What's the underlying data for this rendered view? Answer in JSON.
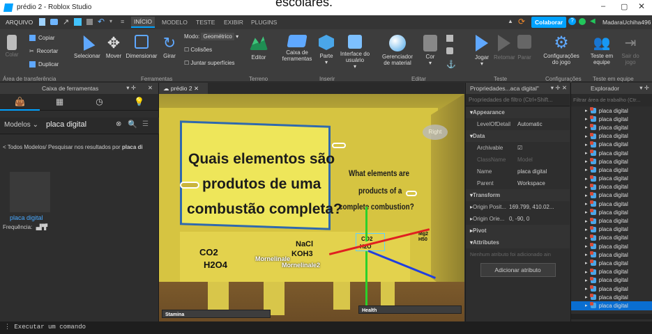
{
  "window": {
    "title": "prédio 2 - Roblox Studio",
    "partial_caption": "escolares."
  },
  "menu": {
    "arquivo": "ARQUIVO",
    "inicio": "INÍCIO",
    "modelo": "MODELO",
    "teste": "TESTE",
    "exibir": "EXIBIR",
    "plugins": "PLUGINS",
    "colaborar": "Colaborar",
    "user": "MadaraUchiha496"
  },
  "ribbon": {
    "clipboard": {
      "colar": "Colar",
      "copiar": "Copiar",
      "recortar": "Recortar",
      "duplicar": "Duplicar",
      "group": "Área de transferência"
    },
    "tools": {
      "selecionar": "Selecionar",
      "mover": "Mover",
      "dimensionar": "Dimensionar",
      "girar": "Girar",
      "modo_label": "Modo:",
      "modo_value": "Geométrico",
      "colisoes": "Colisões",
      "juntar": "Juntar superfícies",
      "group": "Ferramentas"
    },
    "terrain": {
      "editor": "Editor",
      "group": "Terreno"
    },
    "insert": {
      "caixa": "Caixa de ferramentas",
      "parte": "Parte",
      "interface": "Interface do usuário",
      "group": "Inserir"
    },
    "edit": {
      "gerenciador": "Gerenciador de material",
      "cor": "Cor",
      "group": "Editar"
    },
    "test": {
      "jogar": "Jogar",
      "retomar": "Retomar",
      "parar": "Parar",
      "group": "Teste"
    },
    "settings": {
      "config": "Configurações do jogo",
      "group": "Configurações"
    },
    "team": {
      "teste_equipe": "Teste em equipe",
      "sair": "Sair do jogo",
      "group": "Teste em equipe"
    }
  },
  "toolbox": {
    "title": "Caixa de ferramentas",
    "category": "Modelos",
    "search_value": "placa digital",
    "breadcrumb_prefix": "< Todos Modelos/ Pesquisar nos resultados por ",
    "breadcrumb_query": "placa di",
    "result_name": "placa digital",
    "frequency_label": "Frequência:"
  },
  "viewport": {
    "tab": "prédio 2",
    "board_pt_line1": "Quais elementos são",
    "board_pt_line2": "produtos de uma",
    "board_pt_line3": "combustão completa?",
    "board_en_line1": "What elements are",
    "board_en_line2": "products of a",
    "board_en_line3": "complete combustion?",
    "co2": "CO2",
    "h2o4": "H2O4",
    "nacl": "NaCl",
    "koh3": "KOH3",
    "mornelinale": "Mornelinale",
    "mornelinale2": "Mornelinale2",
    "co2b": "CO2",
    "h2o": "H2O",
    "mg2": "Mg2",
    "h50": "H50",
    "right_label": "Right",
    "stamina": "Stamina",
    "health": "Health"
  },
  "properties": {
    "title": "Propriedades...aca digital\"",
    "filter_placeholder": "Propriedades de filtro (Ctrl+Shift...",
    "rows": [
      {
        "k": "Appearance",
        "v": "",
        "sec": true
      },
      {
        "k": "LevelOfDetail",
        "v": "Automatic",
        "sec": false
      },
      {
        "k": "Data",
        "v": "",
        "sec": true
      },
      {
        "k": "Archivable",
        "v": "☑",
        "sec": false
      },
      {
        "k": "ClassName",
        "v": "Model",
        "sec": false,
        "dim": true
      },
      {
        "k": "Name",
        "v": "placa digital",
        "sec": false
      },
      {
        "k": "Parent",
        "v": "Workspace",
        "sec": false
      },
      {
        "k": "Transform",
        "v": "",
        "sec": true
      },
      {
        "k": "Origin Posit...",
        "v": "169.799, 410.02...",
        "sec": false
      },
      {
        "k": "Origin Orie...",
        "v": "0, -90, 0",
        "sec": false
      },
      {
        "k": "Pivot",
        "v": "",
        "sec": true
      },
      {
        "k": "Attributes",
        "v": "",
        "sec": true
      }
    ],
    "no_attr": "Nenhum atributo foi adicionado ain",
    "add_attr": "Adicionar atributo"
  },
  "explorer": {
    "title": "Explorador",
    "filter_placeholder": "Filtrar área de trabalho (Ctr...",
    "item": "placa digital",
    "count": 24
  },
  "command": {
    "placeholder": "Executar um comando"
  },
  "colors": {
    "accent": "#00a2ff",
    "wall": "#c9b43a",
    "board": "#f4ee5c"
  }
}
